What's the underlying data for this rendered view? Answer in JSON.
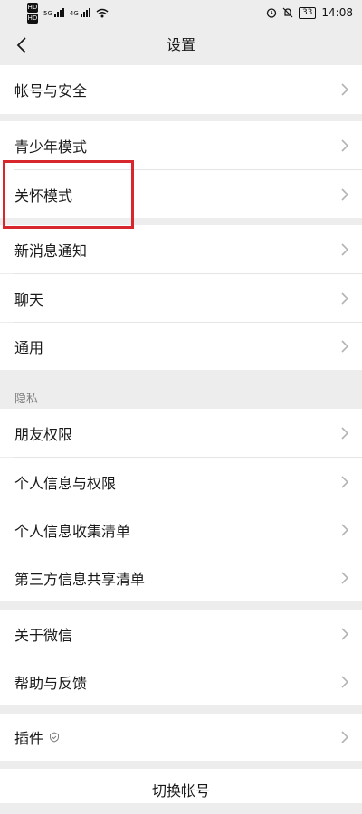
{
  "status_bar": {
    "hd1": "HD",
    "hd2": "HD",
    "net1": "5G",
    "net2": "4G",
    "battery": "33",
    "time": "14:08"
  },
  "header": {
    "title": "设置"
  },
  "rows": {
    "account_security": "帐号与安全",
    "teen_mode": "青少年模式",
    "care_mode": "关怀模式",
    "new_message_notify": "新消息通知",
    "chat": "聊天",
    "general": "通用",
    "friend_permissions": "朋友权限",
    "personal_info_permissions": "个人信息与权限",
    "personal_info_collection": "个人信息收集清单",
    "third_party_sharing": "第三方信息共享清单",
    "about_wechat": "关于微信",
    "help_feedback": "帮助与反馈",
    "plugins": "插件"
  },
  "sections": {
    "privacy": "隐私"
  },
  "footer": {
    "switch_account": "切换帐号"
  },
  "colors": {
    "background": "#ededed",
    "row": "#ffffff",
    "highlight": "#d7262c",
    "chevron": "#b2b2b2"
  }
}
